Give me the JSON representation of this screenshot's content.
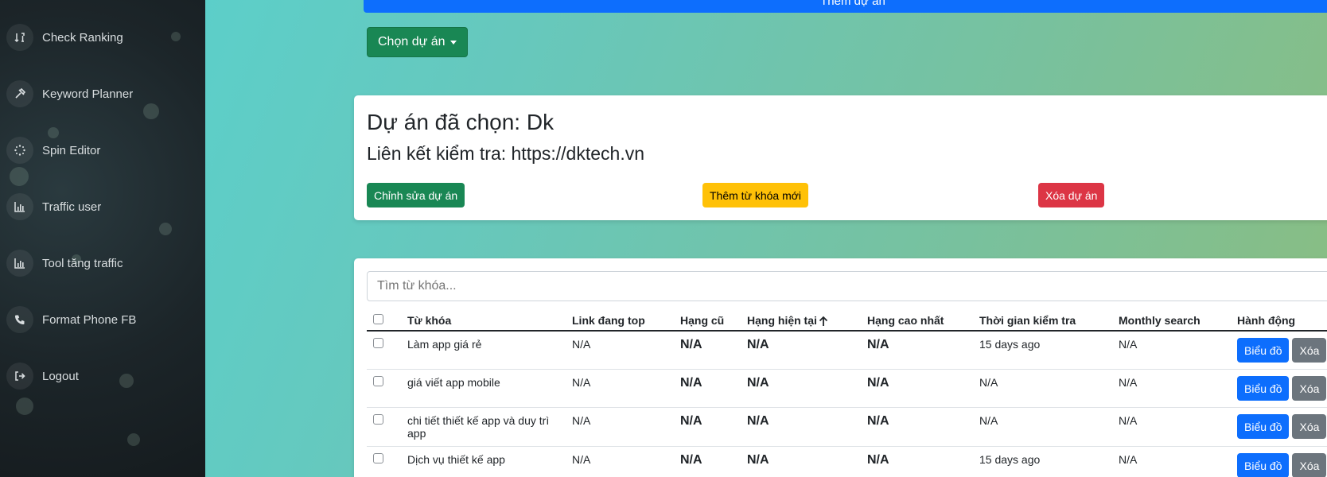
{
  "sidebar": {
    "items": [
      {
        "label": "Check Ranking",
        "icon": "sort-numeric-icon"
      },
      {
        "label": "Keyword Planner",
        "icon": "tools-icon"
      },
      {
        "label": "Spin Editor",
        "icon": "spinner-icon"
      },
      {
        "label": "Traffic user",
        "icon": "chart-bar-icon"
      },
      {
        "label": "Tool tăng traffic",
        "icon": "chart-bar-icon"
      },
      {
        "label": "Format Phone FB",
        "icon": "phone-icon"
      },
      {
        "label": "Logout",
        "icon": "sign-out-icon"
      }
    ]
  },
  "header": {
    "add_project_label": "Thêm dự án",
    "select_project_label": "Chọn dự án"
  },
  "project": {
    "title": "Dự án đã chọn: Dk",
    "link": "Liên kết kiểm tra: https://dktech.vn",
    "edit_label": "Chỉnh sửa dự án",
    "add_keyword_label": "Thêm từ khóa mới",
    "delete_label": "Xóa dự án"
  },
  "keywords": {
    "search_placeholder": "Tìm từ khóa...",
    "columns": [
      "Từ khóa",
      "Link đang top",
      "Hạng cũ",
      "Hạng hiện tại",
      "Hạng cao nhất",
      "Thời gian kiểm tra",
      "Monthly search",
      "Hành động"
    ],
    "rows": [
      {
        "keyword": "Làm app giá rẻ",
        "link": "N/A",
        "old_rank": "N/A",
        "current_rank": "N/A",
        "best_rank": "N/A",
        "checked": "15 days ago",
        "monthly": "N/A"
      },
      {
        "keyword": "giá viết app mobile",
        "link": "N/A",
        "old_rank": "N/A",
        "current_rank": "N/A",
        "best_rank": "N/A",
        "checked": "N/A",
        "monthly": "N/A"
      },
      {
        "keyword": "chi tiết thiết kế app và duy trì app",
        "link": "N/A",
        "old_rank": "N/A",
        "current_rank": "N/A",
        "best_rank": "N/A",
        "checked": "N/A",
        "monthly": "N/A"
      },
      {
        "keyword": "Dịch vụ thiết kế app",
        "link": "N/A",
        "old_rank": "N/A",
        "current_rank": "N/A",
        "best_rank": "N/A",
        "checked": "15 days ago",
        "monthly": "N/A"
      }
    ],
    "chart_label": "Biểu đồ",
    "delete_label": "Xóa"
  },
  "colors": {
    "primary": "#0d6efd",
    "success": "#198754",
    "warning": "#ffc107",
    "danger": "#dc3545",
    "secondary": "#6c757d"
  }
}
